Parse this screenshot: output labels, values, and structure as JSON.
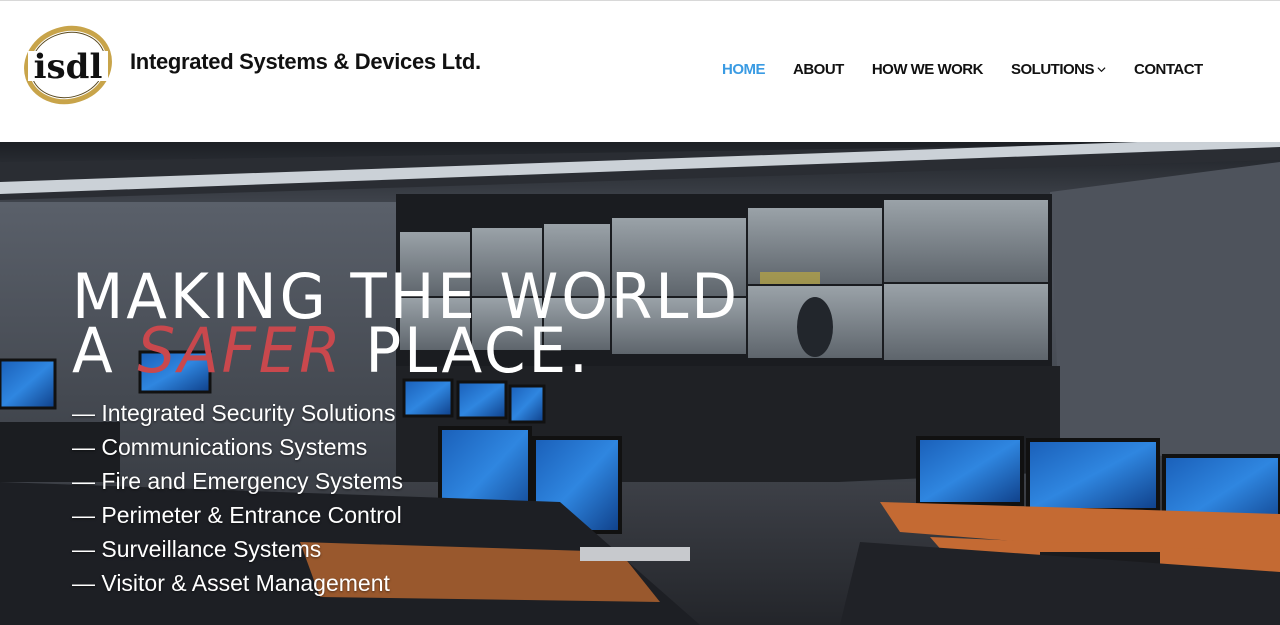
{
  "brand": {
    "logo_text": "isdl",
    "company_name": "Integrated Systems & Devices Ltd."
  },
  "nav": {
    "items": [
      {
        "label": "HOME",
        "active": true
      },
      {
        "label": "ABOUT",
        "active": false
      },
      {
        "label": "HOW WE WORK",
        "active": false
      },
      {
        "label": "SOLUTIONS",
        "active": false,
        "has_dropdown": true
      },
      {
        "label": "CONTACT",
        "active": false
      }
    ]
  },
  "hero": {
    "headline_line1": "MAKING THE WORLD",
    "headline_line2_prefix": "A",
    "headline_accent": "SAFER",
    "headline_line2_suffix": "PLACE.",
    "services": [
      "— Integrated Security Solutions",
      "— Communications Systems",
      "— Fire and Emergency Systems",
      "— Perimeter & Entrance Control",
      "— Surveillance Systems",
      "— Visitor & Asset Management"
    ]
  },
  "colors": {
    "nav_active": "#3a9be3",
    "accent_red": "#c9484d",
    "logo_gold": "#c8a44a"
  }
}
